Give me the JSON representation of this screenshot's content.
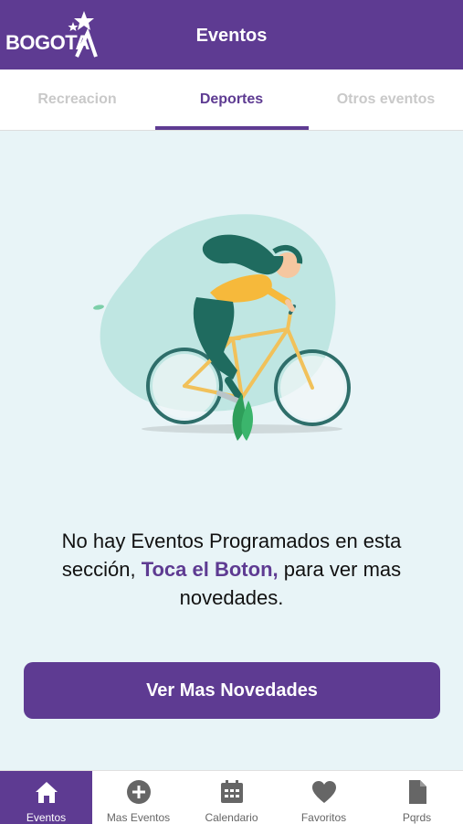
{
  "header": {
    "logo_text": "BOGOTA",
    "title": "Eventos"
  },
  "tabs": [
    {
      "label": "Recreacion",
      "active": false
    },
    {
      "label": "Deportes",
      "active": true
    },
    {
      "label": "Otros eventos",
      "active": false
    }
  ],
  "empty_state": {
    "message_prefix": "No hay Eventos Programados en esta sección,",
    "message_highlight": "Toca el Boton,",
    "message_suffix": "para ver mas novedades.",
    "illustration": "woman-riding-bicycle"
  },
  "cta": {
    "label": "Ver Mas Novedades"
  },
  "bottom_nav": [
    {
      "label": "Eventos",
      "icon": "home-icon",
      "active": true
    },
    {
      "label": "Mas Eventos",
      "icon": "plus-circle-icon",
      "active": false
    },
    {
      "label": "Calendario",
      "icon": "calendar-icon",
      "active": false
    },
    {
      "label": "Favoritos",
      "icon": "heart-icon",
      "active": false
    },
    {
      "label": "Pqrds",
      "icon": "document-icon",
      "active": false
    }
  ],
  "colors": {
    "primary": "#5e3b92",
    "background": "#e8f4f7"
  }
}
